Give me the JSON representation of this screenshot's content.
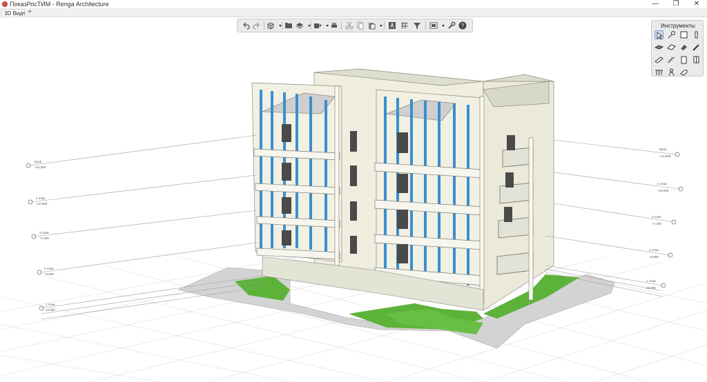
{
  "app": {
    "title": "ПоказРосТИМ - Renga Architecture",
    "window_buttons": [
      "—",
      "❐",
      "✕"
    ]
  },
  "tabs": [
    {
      "label": "3D Вид",
      "close": "✕"
    }
  ],
  "tab_add": "+",
  "toolbar": {
    "icons": [
      "undo-icon",
      "redo-icon",
      "view-cube-icon",
      "dropdown-icon",
      "folder-icon",
      "layers-icon",
      "dropdown-icon",
      "export-icon",
      "dropdown-icon",
      "print-icon",
      "cut-icon",
      "copy-icon",
      "paste-icon",
      "dropdown-icon",
      "text-icon",
      "grid-icon",
      "filter-icon",
      "visibility-icon",
      "dropdown-icon",
      "wrench-icon",
      "help-icon"
    ]
  },
  "tools_panel": {
    "title": "Инструменты",
    "icons": [
      "select-icon",
      "axis-icon",
      "wall-icon",
      "column-icon",
      "slab-icon",
      "roof-icon",
      "eraser-icon",
      "pencil-icon",
      "beam-icon",
      "stair-icon",
      "door-icon",
      "window-icon",
      "railing-icon",
      "equipment-icon",
      "ramp-icon"
    ]
  },
  "levels_left": [
    {
      "name": "Кров",
      "mark": "+14,000"
    },
    {
      "name": "4 этаж",
      "mark": "+10,600"
    },
    {
      "name": "3 этаж",
      "mark": "+7,200"
    },
    {
      "name": "2 этаж",
      "mark": "+3,800"
    },
    {
      "name": "1 этаж",
      "mark": "±0,000"
    }
  ],
  "levels_right": [
    {
      "name": "Кров",
      "mark": "+14,000"
    },
    {
      "name": "4 этаж",
      "mark": "+10,600"
    },
    {
      "name": "3 этаж",
      "mark": "+7,200"
    },
    {
      "name": "2 этаж",
      "mark": "+3,800"
    },
    {
      "name": "1 этаж",
      "mark": "±0,000"
    }
  ],
  "colors": {
    "wall": "#eeeedd",
    "glass": "#3a8fd0",
    "lawn": "#5db33a",
    "paving": "#cfcfcf",
    "grid": "#d9d9d9"
  }
}
